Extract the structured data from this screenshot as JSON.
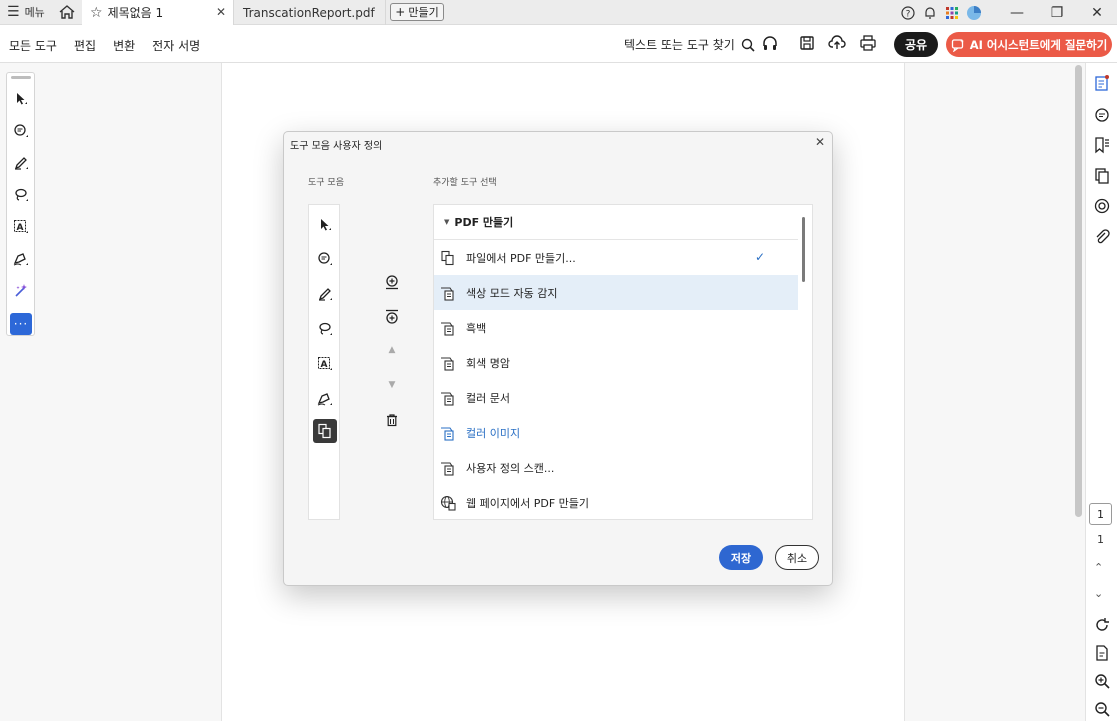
{
  "tabbar": {
    "menu_label": "메뉴",
    "active_tab": "제목없음 1",
    "inactive_tab": "TranscationReport.pdf",
    "new_tab_label": "만들기"
  },
  "toolbar": {
    "menu_items": [
      "모든 도구",
      "편집",
      "변환",
      "전자 서명"
    ],
    "search_text": "텍스트 또는 도구 찾기",
    "share_label": "공유",
    "ai_label": "AI 어시스턴트에게 질문하기"
  },
  "modal": {
    "title": "도구 모음 사용자 정의",
    "left_label": "도구 모음",
    "right_label": "추가할 도구 선택",
    "group_header": "PDF 만들기",
    "items": [
      {
        "label": "파일에서 PDF 만들기...",
        "checked": true
      },
      {
        "label": "색상 모드 자동 감지",
        "highlighted": true
      },
      {
        "label": "흑백"
      },
      {
        "label": "회색 명암"
      },
      {
        "label": "컬러 문서"
      },
      {
        "label": "컬러 이미지",
        "blue": true
      },
      {
        "label": "사용자 정의 스캔..."
      },
      {
        "label": "웹 페이지에서 PDF 만들기"
      }
    ],
    "save_label": "저장",
    "cancel_label": "취소"
  },
  "pager": {
    "current_page": "1",
    "total_pages": "1"
  },
  "colors": {
    "accent_blue": "#2e67d1",
    "ai_button": "#eb5a47",
    "highlight_row": "#e4eef8"
  }
}
